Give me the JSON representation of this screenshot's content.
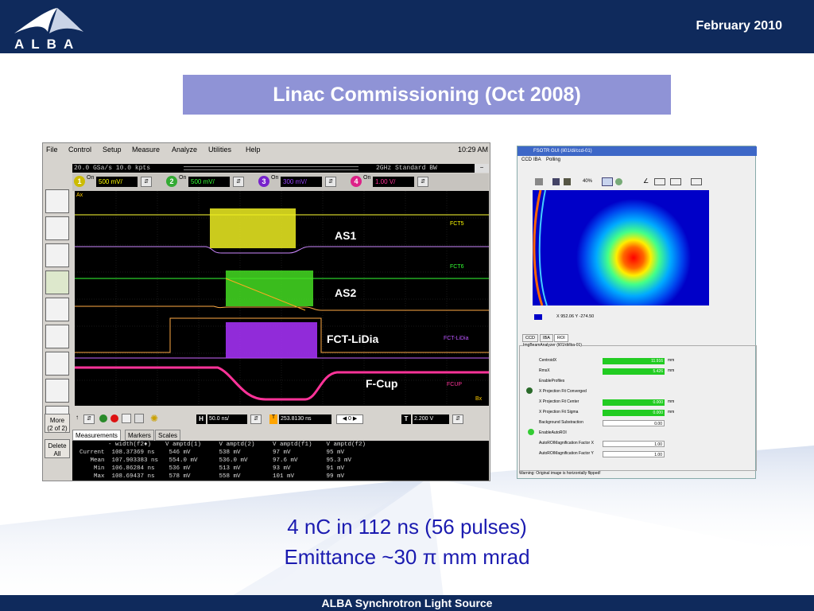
{
  "header": {
    "date": "February 2010",
    "logo": "ALBA"
  },
  "title": "Linac Commissioning (Oct 2008)",
  "scope": {
    "menu": [
      "File",
      "Control",
      "Setup",
      "Measure",
      "Analyze",
      "Utilities",
      "Help"
    ],
    "time": "10:29 AM",
    "status_left": "20.0 GSa/s   10.0 kpts",
    "status_right": "2GHz Standard BW",
    "channels": [
      {
        "num": "1",
        "value": "500 mV/",
        "color": "#ffff00"
      },
      {
        "num": "2",
        "value": "500 mV/",
        "color": "#33cc33"
      },
      {
        "num": "3",
        "value": "300 mV/",
        "color": "#9933ff"
      },
      {
        "num": "4",
        "value": "1.00 V/",
        "color": "#ff3399"
      }
    ],
    "channel_on": "On",
    "screen_corner": "Ax",
    "screen_corner_bottom": "Bx",
    "trace_labels": [
      "AS1",
      "AS2",
      "FCT-LiDia",
      "F-Cup"
    ],
    "trace_tags": [
      "FCT5",
      "FCT6",
      "FCT-LiDia",
      "FCUP"
    ],
    "timebase": "50.0 ns/",
    "position": "253.8130 ns",
    "acq": "0",
    "trigger_level": "2.200 V",
    "tabs": [
      "Measurements",
      "Markers",
      "Scales"
    ],
    "more_label": "More\n(2 of 2)",
    "delete_label": "Delete\nAll",
    "meas_rows": [
      "          - width(f2♦)    V amptd(1)     V amptd(2)     V amptd(f1)    V amptd(f2)",
      "  Current  108.37369 ns    546 mV        538 mV         97 mV          95 mV",
      "     Mean  107.903383 ns   554.0 mV      536.0 mV       97.6 mV        95.3 mV",
      "      Min  106.86284 ns    536 mV        513 mV         93 mV          91 mV",
      "      Max  108.69437 ns    578 mV        558 mV         101 mV         99 mV"
    ]
  },
  "gui": {
    "title": "FSOTR GUI (li01/di/ccd-01)",
    "menu": [
      "CCD",
      "IBA",
      "Polling"
    ],
    "zoom": "40%",
    "coord": "X  952.06   Y  -274.50",
    "tabs": [
      "CCD",
      "IBA",
      "ROI"
    ],
    "form_title": "ImgBeamAnalyzer  (li01/di/iba-01)",
    "rows": [
      {
        "label": "CentroidX",
        "value": "11.916",
        "unit": "mm"
      },
      {
        "label": "RmsX",
        "value": "5.426",
        "unit": "mm"
      },
      {
        "label": "EnableProfiles",
        "value": "",
        "unit": ""
      },
      {
        "label": "X Projection Fit Converged",
        "value": "",
        "unit": ""
      },
      {
        "label": "X Projection Fit Center",
        "value": "0.000",
        "unit": "mm"
      },
      {
        "label": "X Projection Fit Sigma",
        "value": "0.000",
        "unit": "mm"
      },
      {
        "label": "Background Substraction",
        "value": "0.00",
        "unit": ""
      },
      {
        "label": "EnableAutoROI",
        "value": "",
        "unit": ""
      },
      {
        "label": "AutoROIMagnification Factor X",
        "value": "1.00",
        "unit": ""
      },
      {
        "label": "AutoROIMagnification Factor Y",
        "value": "1.00",
        "unit": ""
      }
    ],
    "warning": "Warning: Original image is horizontally flipped!"
  },
  "body_lines": [
    "4 nC in 112 ns (56 pulses)",
    "Emittance ~30 π mm mrad"
  ],
  "footer": "ALBA Synchrotron Light Source",
  "colors": {
    "navy": "#0f2a5c",
    "title_box": "#8f93d6",
    "body_text": "#1b1bb0"
  }
}
